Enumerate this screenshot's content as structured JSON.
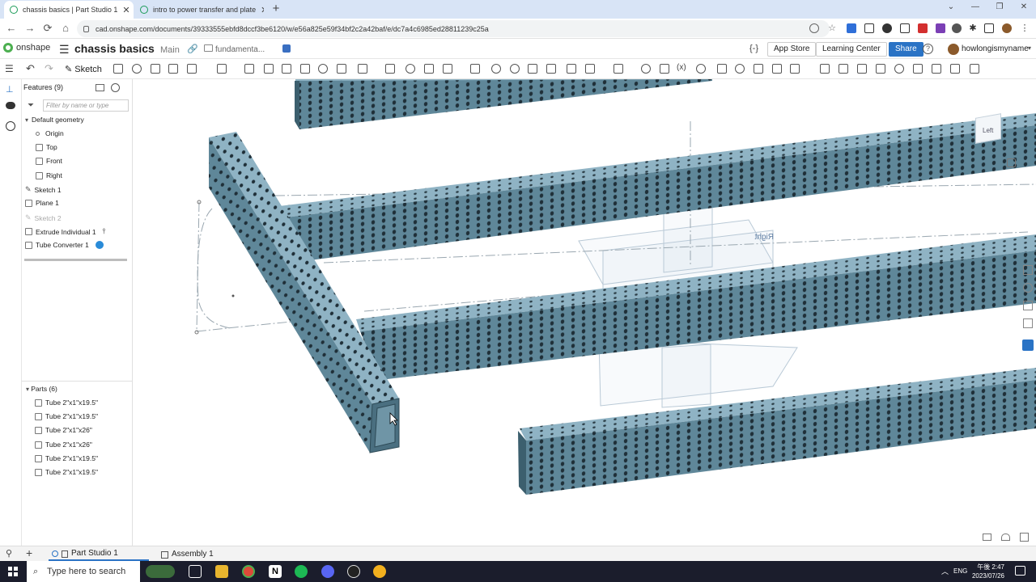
{
  "browser": {
    "tabs": [
      {
        "title": "chassis basics | Part Studio 1",
        "active": true
      },
      {
        "title": "intro to power transfer and plate",
        "active": false
      }
    ],
    "url": "cad.onshape.com/documents/39333555ebfd8dccf3be6120/w/e56a825e59f34bf2c2a42baf/e/dc7a4c6985ed28811239c25a",
    "new_tab": "+",
    "window_controls": [
      "⌄",
      "—",
      "❐",
      "✕"
    ]
  },
  "header": {
    "logo_text": "onshape",
    "document_name": "chassis basics",
    "branch": "Main",
    "folder": "fundamenta...",
    "app_store": "App Store",
    "learning_center": "Learning Center",
    "share": "Share",
    "username": "howlongismyname",
    "code_icon": "{-}"
  },
  "toolbar": {
    "sketch_label": "Sketch"
  },
  "features": {
    "header": "Features (9)",
    "filter_placeholder": "Filter by name or type",
    "items": [
      {
        "label": "Default geometry",
        "icon": "chevron-down",
        "dim": false
      },
      {
        "label": "Origin",
        "icon": "origin",
        "dim": false
      },
      {
        "label": "Top",
        "icon": "plane",
        "dim": false
      },
      {
        "label": "Front",
        "icon": "plane",
        "dim": false
      },
      {
        "label": "Right",
        "icon": "plane",
        "dim": false
      },
      {
        "label": "Sketch 1",
        "icon": "sketch",
        "dim": false
      },
      {
        "label": "Plane 1",
        "icon": "plane",
        "dim": false
      },
      {
        "label": "Sketch 2",
        "icon": "sketch",
        "dim": true
      },
      {
        "label": "Extrude Individual 1",
        "icon": "extrude",
        "dim": false
      },
      {
        "label": "Tube Converter 1",
        "icon": "feature-studio",
        "dim": false
      }
    ]
  },
  "parts": {
    "header": "Parts (6)",
    "items": [
      "Tube 2\"x1\"x19.5\"",
      "Tube 2\"x1\"x19.5\"",
      "Tube 2\"x1\"x26\"",
      "Tube 2\"x1\"x26\"",
      "Tube 2\"x1\"x19.5\"",
      "Tube 2\"x1\"x19.5\""
    ]
  },
  "viewport": {
    "plane_label": "Right",
    "view_cube_label": "Left",
    "colors": {
      "tube": "#5f8799",
      "tube_top": "#8fb3c4",
      "hole": "#1f2f38"
    }
  },
  "bottom_tabs": [
    {
      "label": "Part Studio 1",
      "active": true
    },
    {
      "label": "Assembly 1",
      "active": false
    }
  ],
  "taskbar": {
    "search_placeholder": "Type here to search",
    "language": "ENG",
    "time": "午後 2:47",
    "date": "2023/07/26"
  }
}
